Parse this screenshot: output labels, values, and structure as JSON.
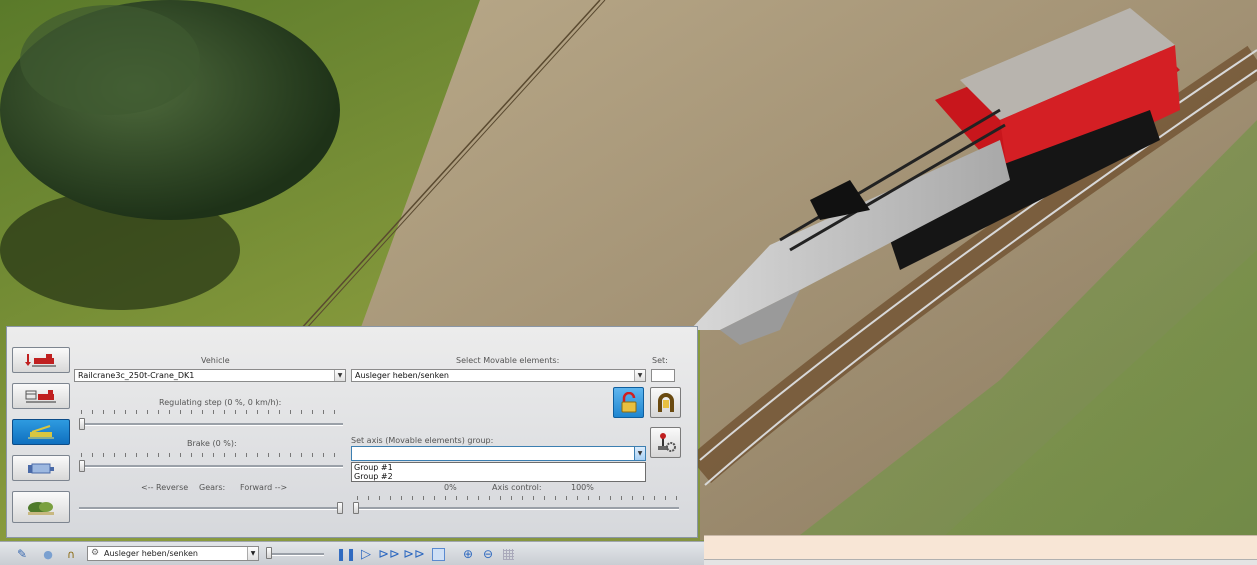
{
  "panel": {
    "vehicle_label": "Vehicle",
    "vehicle_value": "Railcrane3c_250t-Crane_DK1",
    "movable_label": "Select Movable elements:",
    "movable_value": "Ausleger heben/senken",
    "set_label": "Set:",
    "regulating_label": "Regulating step (0 %, 0 km/h):",
    "brake_label": "Brake (0 %):",
    "axis_group_label": "Set axis (Movable elements) group:",
    "axis_group_value": "",
    "axis_group_options": [
      "Group #1",
      "Group #2"
    ],
    "reverse_label": "<-- Reverse",
    "gears_label": "Gears:",
    "forward_label": "Forward -->",
    "axis_pct_min": "0%",
    "axis_control_label": "Axis control:",
    "axis_pct_max": "100%",
    "regulating_level": 0,
    "brake_level": 0,
    "gear_position": 1.0,
    "axis_level": 0
  },
  "side_buttons": [
    {
      "icon": "locomotive-red-arrow-icon",
      "active": false
    },
    {
      "icon": "locomotive-timetable-icon",
      "active": false
    },
    {
      "icon": "crane-wagon-icon",
      "active": true
    },
    {
      "icon": "coupling-icon",
      "active": false
    },
    {
      "icon": "landscape-icon",
      "active": false
    }
  ],
  "icon_buttons": [
    "lock-open-icon",
    "magnet-grab-icon",
    "joystick-gear-icon"
  ],
  "toolbar": {
    "movable_combo_value": "Ausleger heben/senken"
  },
  "colors": {
    "panel_bg": "#dcdee2",
    "active_blue": "#1a7fcf",
    "toolbar_bg": "#d4d8de",
    "status_peach": "#f8e6d6"
  }
}
